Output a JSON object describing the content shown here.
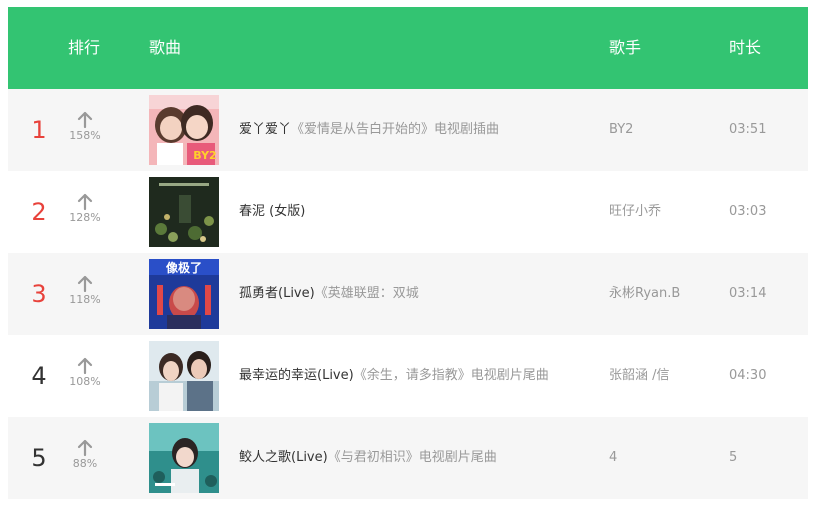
{
  "header": {
    "rank": "排行",
    "song": "歌曲",
    "artist": "歌手",
    "duration": "时长"
  },
  "colors": {
    "header_bg": "#33c472",
    "top_rank": "#e8423b",
    "row_alt": "#f6f6f6"
  },
  "songs": [
    {
      "rank": "1",
      "trend_icon": "arrow-up-icon",
      "trend": "158%",
      "title": "爱丫爱丫",
      "subtitle": "《爱情是从告白开始的》电视剧插曲",
      "artist": "BY2",
      "duration": "03:51",
      "cover_text": "BY2"
    },
    {
      "rank": "2",
      "trend_icon": "arrow-up-icon",
      "trend": "128%",
      "title": "春泥 (女版)",
      "subtitle": "",
      "artist": "旺仔小乔",
      "duration": "03:03",
      "cover_text": ""
    },
    {
      "rank": "3",
      "trend_icon": "arrow-up-icon",
      "trend": "118%",
      "title": "孤勇者(Live)",
      "subtitle": "《英雄联盟：双城",
      "artist": "永彬Ryan.B",
      "duration": "03:14",
      "cover_text": "像极了"
    },
    {
      "rank": "4",
      "trend_icon": "arrow-up-icon",
      "trend": "108%",
      "title": "最幸运的幸运(Live)",
      "subtitle": "《余生，请多指教》电视剧片尾曲",
      "artist": "张韶涵 /信",
      "duration": "04:30",
      "cover_text": ""
    },
    {
      "rank": "5",
      "trend_icon": "arrow-up-icon",
      "trend": "88%",
      "title": "鲛人之歌(Live)",
      "subtitle": "《与君初相识》电视剧片尾曲",
      "artist": "4",
      "duration": "5",
      "cover_text": ""
    }
  ]
}
